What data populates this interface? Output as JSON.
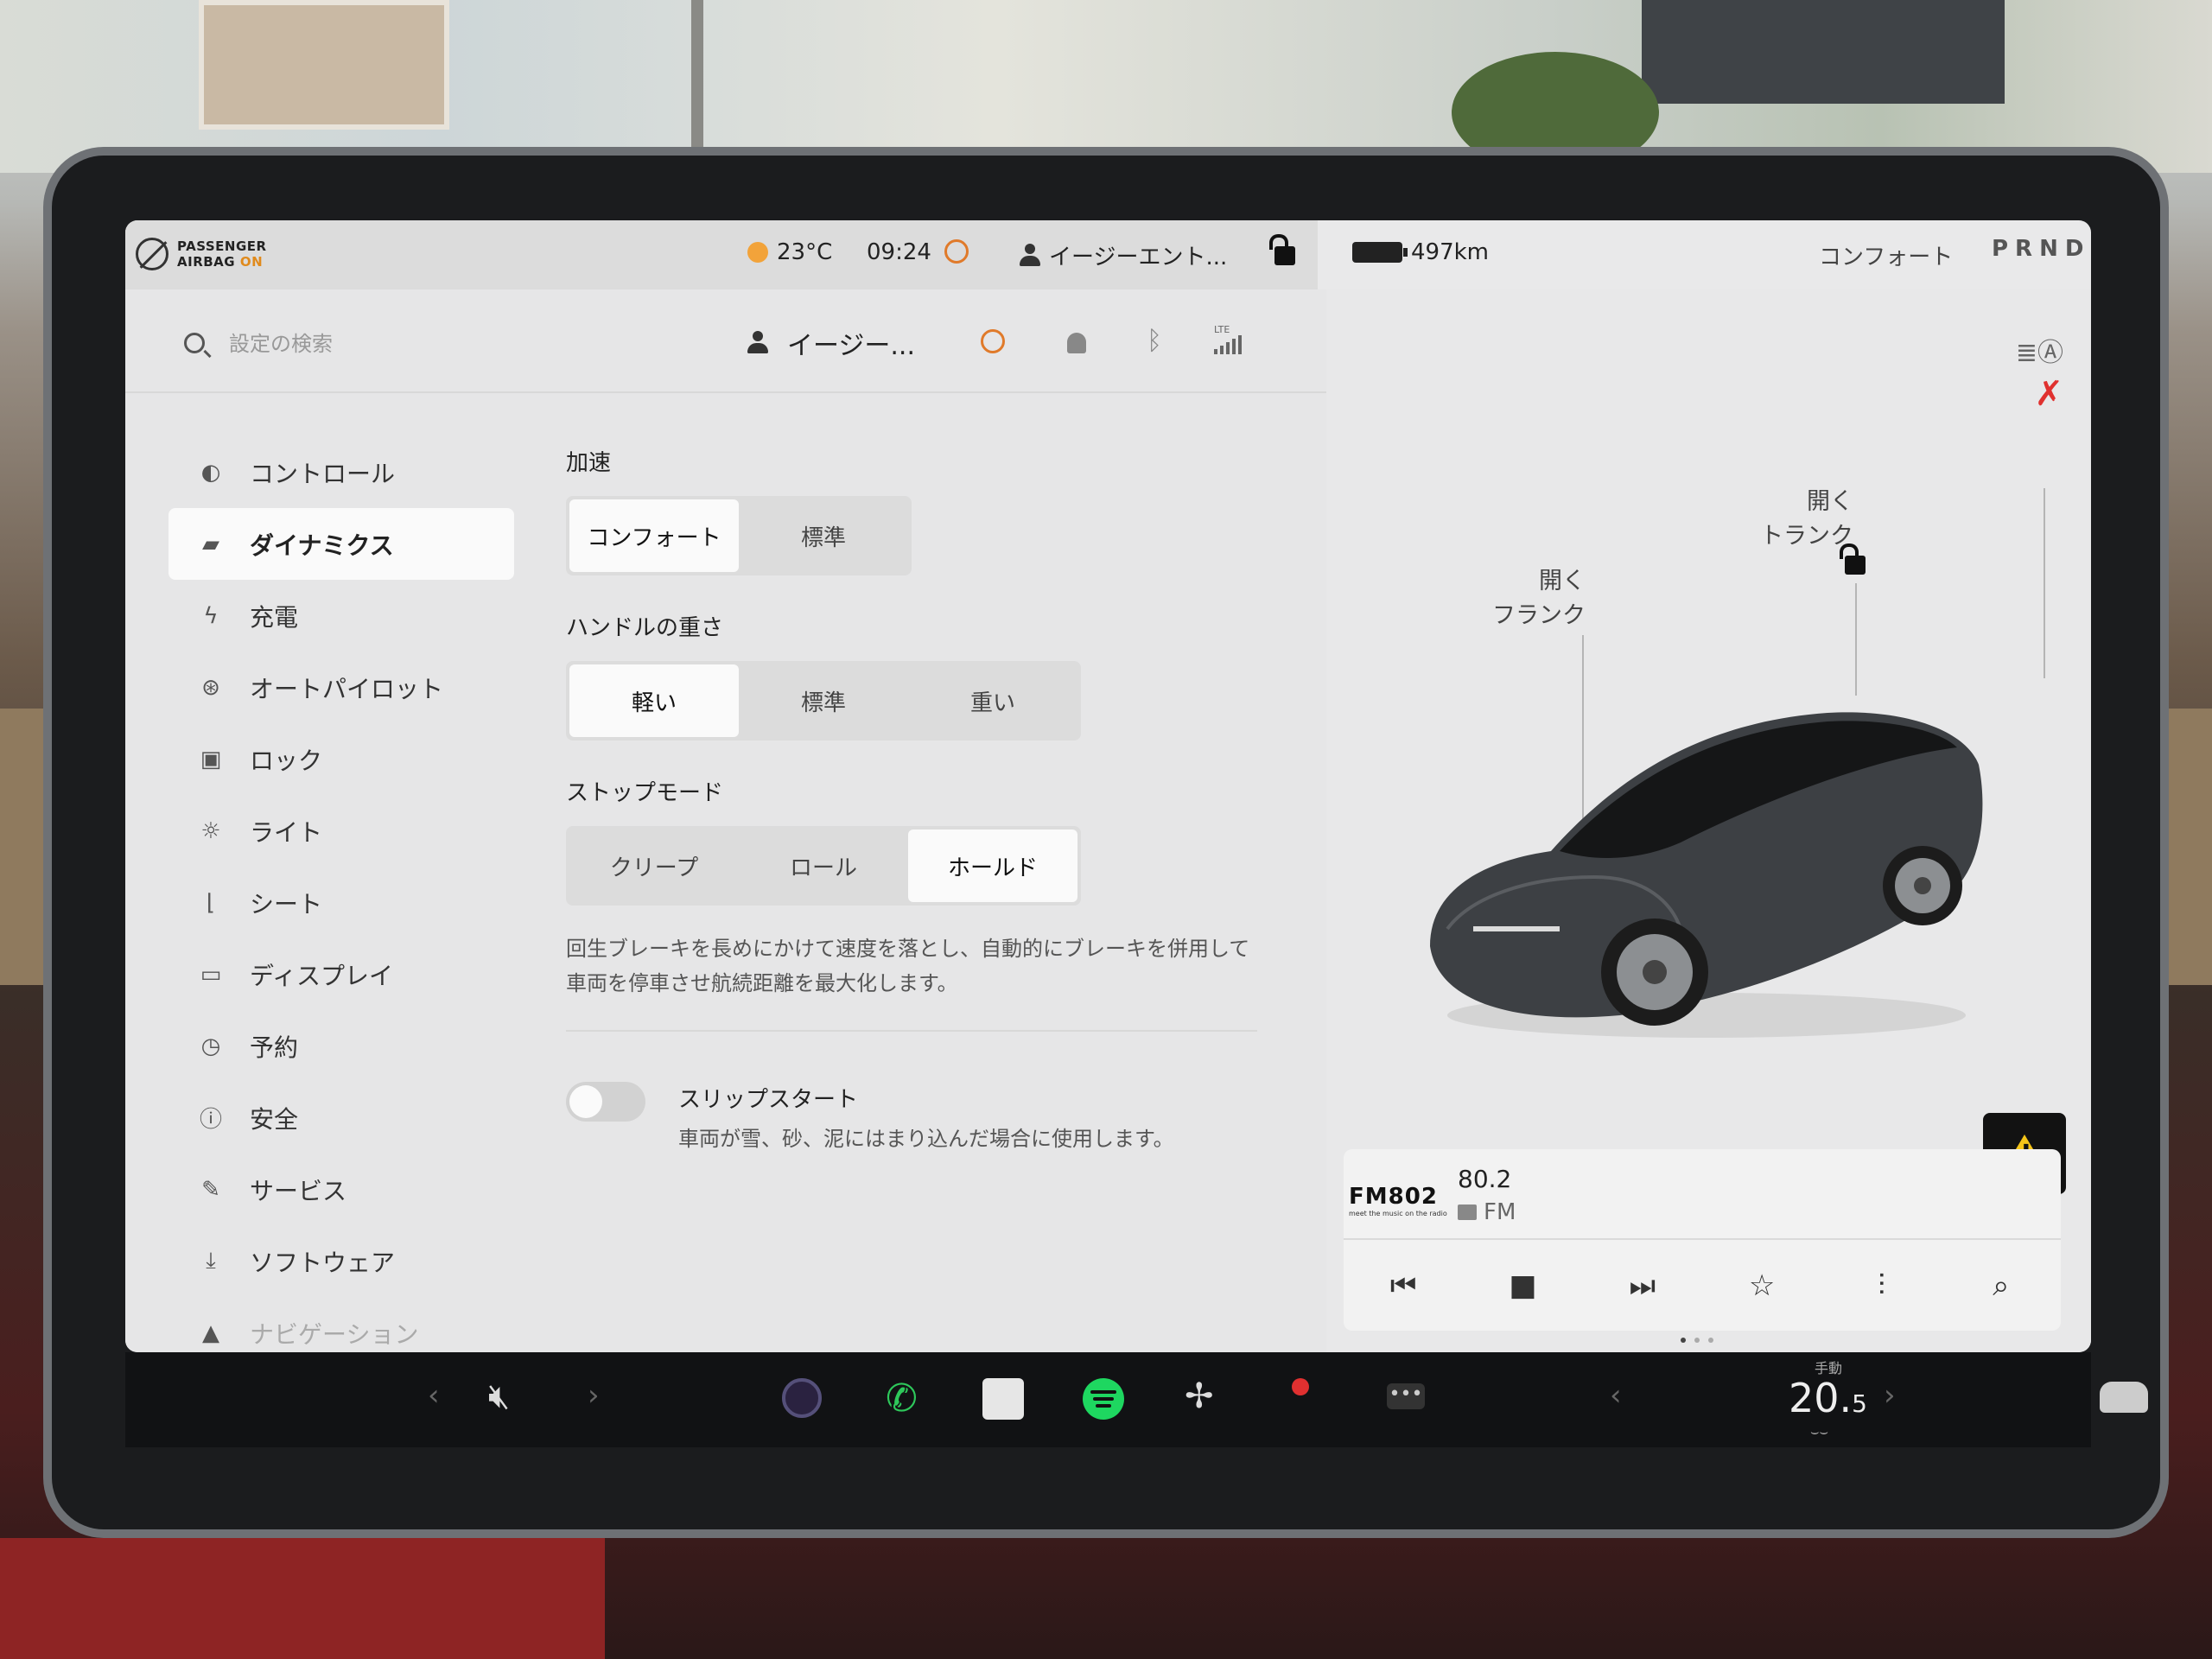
{
  "status": {
    "airbag_line1": "PASSENGER",
    "airbag_line2": "AIRBAG",
    "airbag_state": "ON",
    "temperature": "23°C",
    "time": "09:24",
    "profile": "イージーエント...",
    "range": "497km",
    "drive_mode": "コンフォート",
    "gear": "PRND"
  },
  "settings": {
    "search_placeholder": "設定の検索",
    "profile_short": "イージー...",
    "lte": "LTE",
    "nav": [
      {
        "label": "コントロール",
        "icon": "toggle-icon"
      },
      {
        "label": "ダイナミクス",
        "icon": "car-icon"
      },
      {
        "label": "充電",
        "icon": "bolt-icon"
      },
      {
        "label": "オートパイロット",
        "icon": "steering-wheel-icon"
      },
      {
        "label": "ロック",
        "icon": "lock-icon"
      },
      {
        "label": "ライト",
        "icon": "light-icon"
      },
      {
        "label": "シート",
        "icon": "seat-icon"
      },
      {
        "label": "ディスプレイ",
        "icon": "display-icon"
      },
      {
        "label": "予約",
        "icon": "clock-icon"
      },
      {
        "label": "安全",
        "icon": "info-icon"
      },
      {
        "label": "サービス",
        "icon": "wrench-icon"
      },
      {
        "label": "ソフトウェア",
        "icon": "download-icon"
      },
      {
        "label": "ナビゲーション",
        "icon": "navigation-icon"
      }
    ],
    "active_nav": "ダイナミクス",
    "acceleration": {
      "label": "加速",
      "options": [
        "コンフォート",
        "標準"
      ],
      "selected": "コンフォート"
    },
    "steering": {
      "label": "ハンドルの重さ",
      "options": [
        "軽い",
        "標準",
        "重い"
      ],
      "selected": "軽い"
    },
    "stop_mode": {
      "label": "ストップモード",
      "options": [
        "クリープ",
        "ロール",
        "ホールド"
      ],
      "selected": "ホールド"
    },
    "stop_mode_desc_1": "回生ブレーキを長めにかけて速度を落とし、自動的にブレーキを併用して",
    "stop_mode_desc_2": "車両を停車させ航続距離を最大化します。",
    "slip_start": {
      "title": "スリップスタート",
      "desc": "車両が雪、砂、泥にはまり込んだ場合に使用します。",
      "enabled": false
    }
  },
  "car_view": {
    "frunk_open_1": "開く",
    "frunk_open_2": "フランク",
    "trunk_open_1": "開く",
    "trunk_open_2": "トランク"
  },
  "media": {
    "station_logo": "FM802",
    "station_tagline": "meet the music on the radio",
    "frequency": "80.2",
    "band": "FM"
  },
  "dock": {
    "climate_mode": "手動",
    "temp_int": "20.",
    "temp_dec": "5"
  },
  "colors": {
    "accent_orange": "#e08a1c",
    "warning_yellow": "#f5c518",
    "phone_green": "#2ec85b",
    "spotify_green": "#1ed760",
    "seatbelt_red": "#e0312f"
  }
}
